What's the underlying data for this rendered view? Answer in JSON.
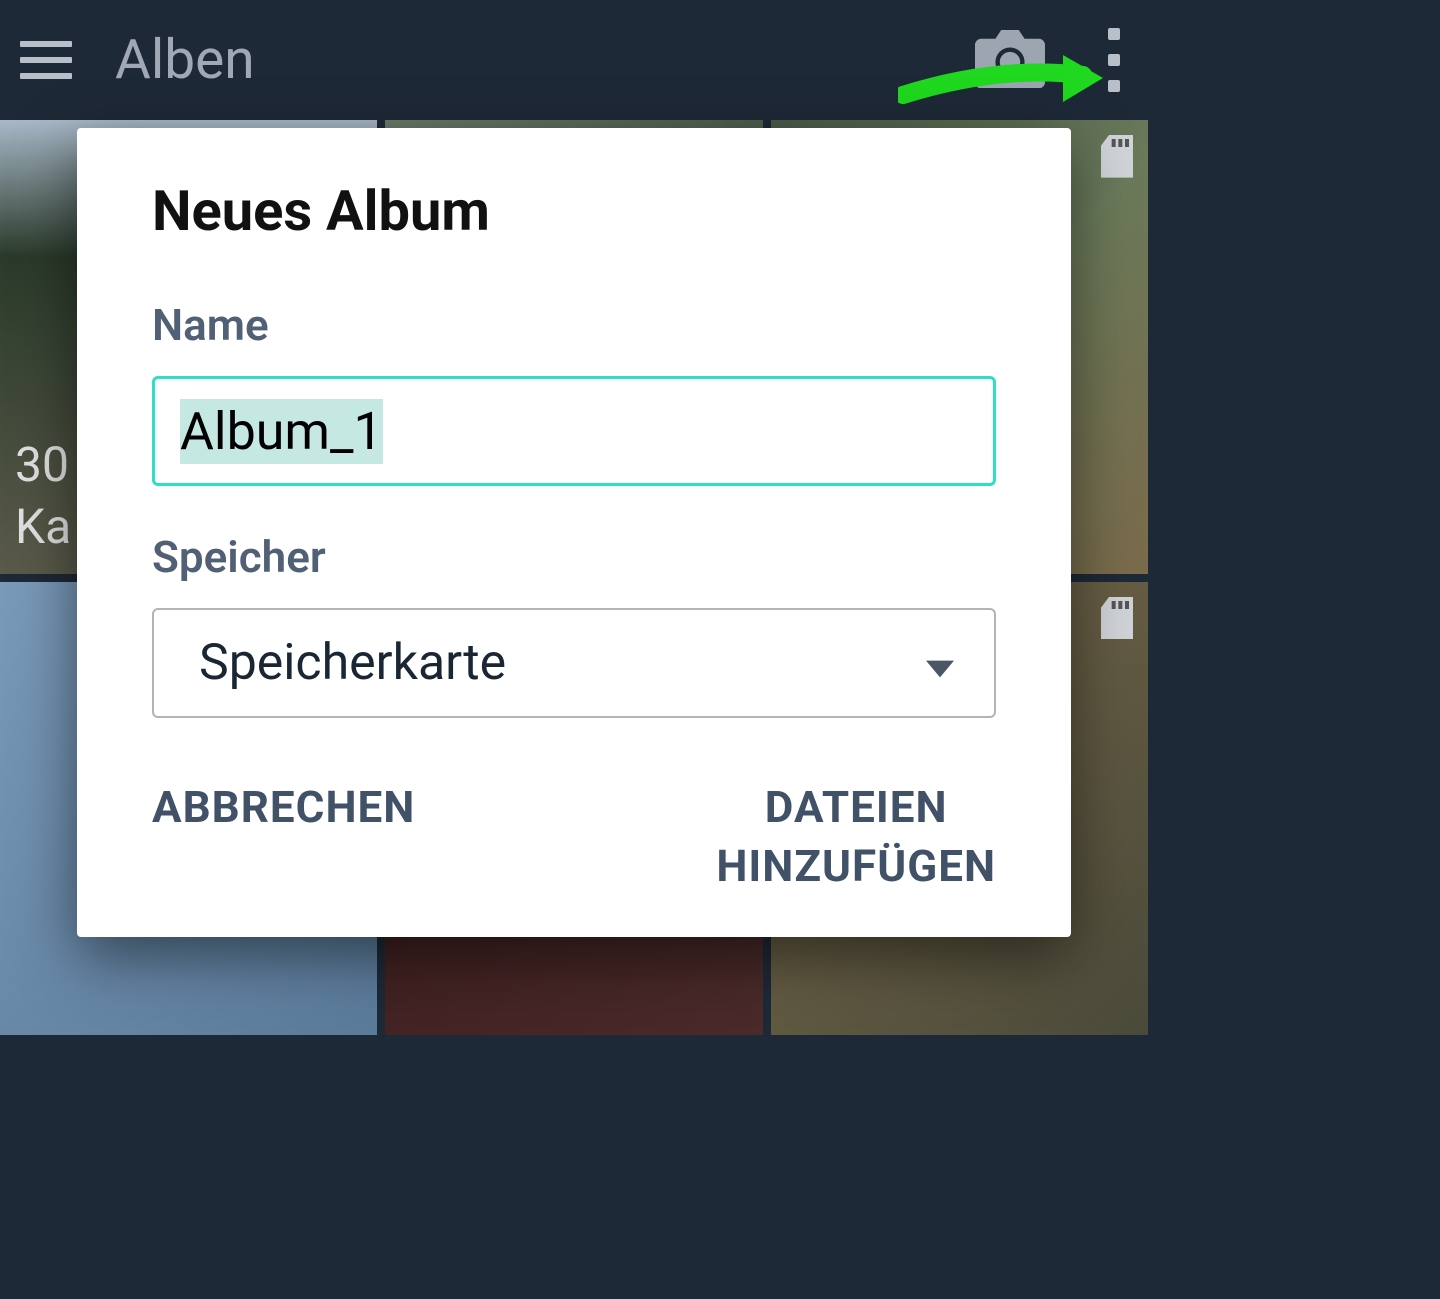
{
  "appbar": {
    "title": "Alben"
  },
  "album": {
    "row1_count": "30",
    "row1_name": "Ka"
  },
  "dialog": {
    "title": "Neues Album",
    "name_label": "Name",
    "name_value": "Album_1",
    "storage_label": "Speicher",
    "storage_value": "Speicherkarte",
    "cancel": "ABBRECHEN",
    "confirm_line1": "DATEIEN",
    "confirm_line2": "HINZUFÜGEN"
  }
}
